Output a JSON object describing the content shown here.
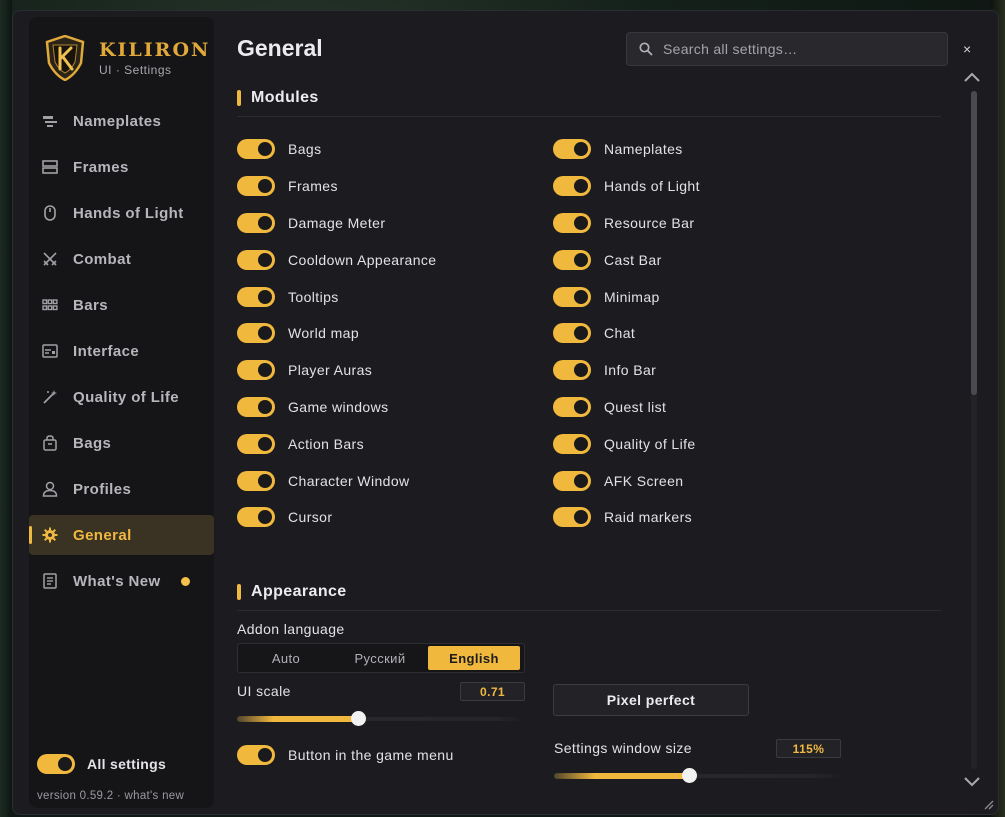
{
  "brand": {
    "name": "KILIRON",
    "subtitle": "UI · Settings"
  },
  "sidebar": {
    "items": [
      {
        "label": "Nameplates",
        "icon": "nameplates-icon"
      },
      {
        "label": "Frames",
        "icon": "frames-icon"
      },
      {
        "label": "Hands of Light",
        "icon": "mouse-icon"
      },
      {
        "label": "Combat",
        "icon": "crossed-swords-icon"
      },
      {
        "label": "Bars",
        "icon": "grid-icon"
      },
      {
        "label": "Interface",
        "icon": "interface-icon"
      },
      {
        "label": "Quality of Life",
        "icon": "magic-wand-icon"
      },
      {
        "label": "Bags",
        "icon": "bag-icon"
      },
      {
        "label": "Profiles",
        "icon": "user-icon"
      },
      {
        "label": "General",
        "icon": "gear-icon",
        "active": true
      },
      {
        "label": "What's New",
        "icon": "document-icon",
        "has_dot": true
      }
    ],
    "all_settings_label": "All settings",
    "all_settings_on": true,
    "version_text": "version 0.59.2 · what's new"
  },
  "header": {
    "title": "General",
    "search_placeholder": "Search all settings…",
    "close_symbol": "×"
  },
  "modules": {
    "heading": "Modules",
    "left": [
      {
        "label": "Bags",
        "on": true
      },
      {
        "label": "Frames",
        "on": true
      },
      {
        "label": "Damage Meter",
        "on": true
      },
      {
        "label": "Cooldown Appearance",
        "on": true
      },
      {
        "label": "Tooltips",
        "on": true
      },
      {
        "label": "World map",
        "on": true
      },
      {
        "label": "Player Auras",
        "on": true
      },
      {
        "label": "Game windows",
        "on": true
      },
      {
        "label": "Action Bars",
        "on": true
      },
      {
        "label": "Character Window",
        "on": true
      },
      {
        "label": "Cursor",
        "on": true
      }
    ],
    "right": [
      {
        "label": "Nameplates",
        "on": true
      },
      {
        "label": "Hands of Light",
        "on": true
      },
      {
        "label": "Resource Bar",
        "on": true
      },
      {
        "label": "Cast Bar",
        "on": true
      },
      {
        "label": "Minimap",
        "on": true
      },
      {
        "label": "Chat",
        "on": true
      },
      {
        "label": "Info Bar",
        "on": true
      },
      {
        "label": "Quest list",
        "on": true
      },
      {
        "label": "Quality of Life",
        "on": true
      },
      {
        "label": "AFK Screen",
        "on": true
      },
      {
        "label": "Raid markers",
        "on": true
      }
    ]
  },
  "appearance": {
    "heading": "Appearance",
    "language_label": "Addon language",
    "language_options": [
      "Auto",
      "Русский",
      "English"
    ],
    "language_selected": "English",
    "ui_scale_label": "UI scale",
    "ui_scale_value": "0.71",
    "ui_scale_fraction": 0.42,
    "pixel_perfect_label": "Pixel perfect",
    "game_menu_button_label": "Button in the game menu",
    "game_menu_button_on": true,
    "window_size_label": "Settings window size",
    "window_size_value": "115%",
    "window_size_fraction": 0.47
  },
  "colors": {
    "accent": "#f0b83c",
    "background": "#1c1c20",
    "sidebar": "#151518"
  }
}
